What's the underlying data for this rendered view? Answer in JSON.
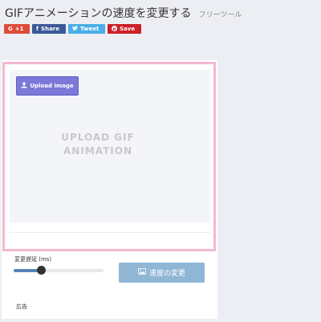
{
  "header": {
    "title": "GIFアニメーションの速度を変更する",
    "subtitle": "フリーツール"
  },
  "share": {
    "gplus": "+1",
    "facebook": "Share",
    "twitter": "Tweet",
    "pinterest": "Save",
    "colors": {
      "gplus": "#dd4b39",
      "facebook": "#3b5998",
      "twitter": "#4aaee7",
      "pinterest": "#cb2027"
    }
  },
  "uploader": {
    "button_label": "Upload image",
    "placeholder_line1": "UPLOAD GIF",
    "placeholder_line2": "ANIMATION",
    "frame_color": "#f2b8cf"
  },
  "controls": {
    "delay_label": "変更遅延 (ms)",
    "slider_fraction": 0.3,
    "change_button": "速度の変更",
    "button_color": "#90b6d6"
  },
  "ad_label": "広告"
}
